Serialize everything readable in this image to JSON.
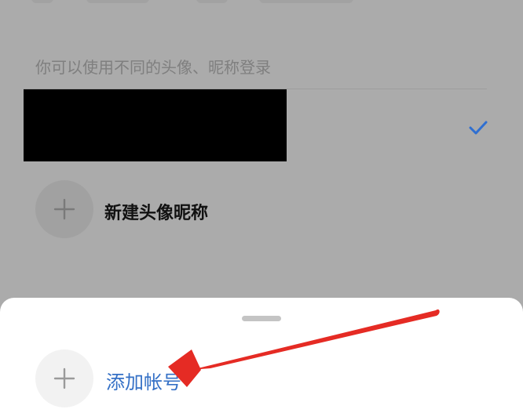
{
  "hint_text": "你可以使用不同的头像、昵称登录",
  "accounts": [
    {
      "selected": true,
      "redacted": true
    }
  ],
  "new_profile_label": "新建头像昵称",
  "sheet": {
    "add_account_label": "添加帐号"
  },
  "icons": {
    "check": "check-icon",
    "plus": "plus-icon"
  },
  "colors": {
    "check": "#2f6fd1",
    "accent_text": "#3470c6",
    "annotation_arrow": "#e52b24"
  }
}
